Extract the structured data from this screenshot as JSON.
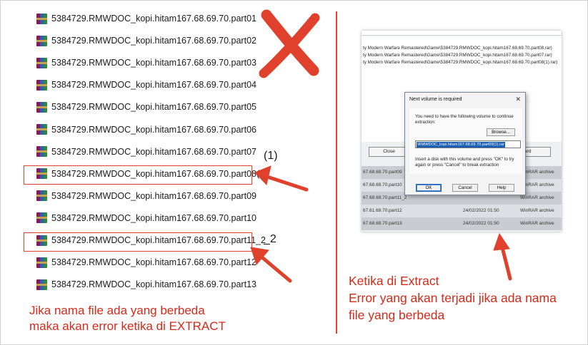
{
  "files": [
    "5384729.RMWDOC_kopi.hitam167.68.69.70.part01",
    "5384729.RMWDOC_kopi.hitam167.68.69.70.part02",
    "5384729.RMWDOC_kopi.hitam167.68.69.70.part03",
    "5384729.RMWDOC_kopi.hitam167.68.69.70.part04",
    "5384729.RMWDOC_kopi.hitam167.68.69.70.part05",
    "5384729.RMWDOC_kopi.hitam167.68.69.70.part06",
    "5384729.RMWDOC_kopi.hitam167.68.69.70.part07",
    "5384729.RMWDOC_kopi.hitam167.68.69.70.part08(1)",
    "5384729.RMWDOC_kopi.hitam167.68.69.70.part09",
    "5384729.RMWDOC_kopi.hitam167.68.69.70.part10",
    "5384729.RMWDOC_kopi.hitam167.68.69.70.part11_2",
    "5384729.RMWDOC_kopi.hitam167.68.69.70.part12",
    "5384729.RMWDOC_kopi.hitam167.68.69.70.part13"
  ],
  "marks": {
    "part08": "(1)",
    "part11": "_2"
  },
  "left_note": [
    "Jika nama file ada yang berbeda",
    "maka akan error ketika di EXTRACT"
  ],
  "right_note": [
    "Ketika di Extract",
    "Error yang akan terjadi jika ada nama",
    "file yang berbeda"
  ],
  "screenshot": {
    "paths": [
      "ty Modern Warfare Remastered\\Game\\5384729.RMWDOC_kopi.hitam167.68.69.70.part08.rar)",
      "ty Modern Warfare Remastered\\Game\\5384729.RMWDOC_kopi.hitam167.68.69.70.part07.rar)",
      "ty Modern Warfare Remastered\\Game\\5384729.RMWDOC_kopi.hitam167.68.69.70.part08(1).rar)"
    ],
    "close_label": "Close",
    "ard_label": "ard",
    "rows": [
      {
        "name": "67.68.69.70.part09",
        "date": "",
        "type": "WinRAR archive"
      },
      {
        "name": "67.68.69.70.part10",
        "date": "24/02/2022 01:50",
        "type": "WinRAR archive"
      },
      {
        "name": "67.68.69.70.part11_2",
        "date": "",
        "type": "WinRAR archive"
      },
      {
        "name": "67.61.69.70.part12",
        "date": "24/02/2022 01:50",
        "type": "WinRAR archive"
      },
      {
        "name": "67.68.69.70.part13",
        "date": "24/02/2022 01:50",
        "type": "WinRAR archive"
      }
    ],
    "dialog": {
      "title": "Next volume is required",
      "close_glyph": "✕",
      "prompt": "You need to have the following volume to continue extraction:",
      "browse_label": "Browse...",
      "volume_value": "\\RMWDOC_kopi.hitam167.68.69.70.part09(1).rar",
      "insert_text": "Insert a disk with this volume and press \"OK\" to try again or press \"Cancel\" to break extraction",
      "ok_label": "OK",
      "cancel_label": "Cancel",
      "help_label": "Help"
    }
  },
  "colors": {
    "accent_red": "#e0412c",
    "note_red": "#d42a1a",
    "selection_blue": "#1a5fb4"
  },
  "icons": [
    "winrar-archive-icon",
    "red-x-mark",
    "red-arrow"
  ]
}
